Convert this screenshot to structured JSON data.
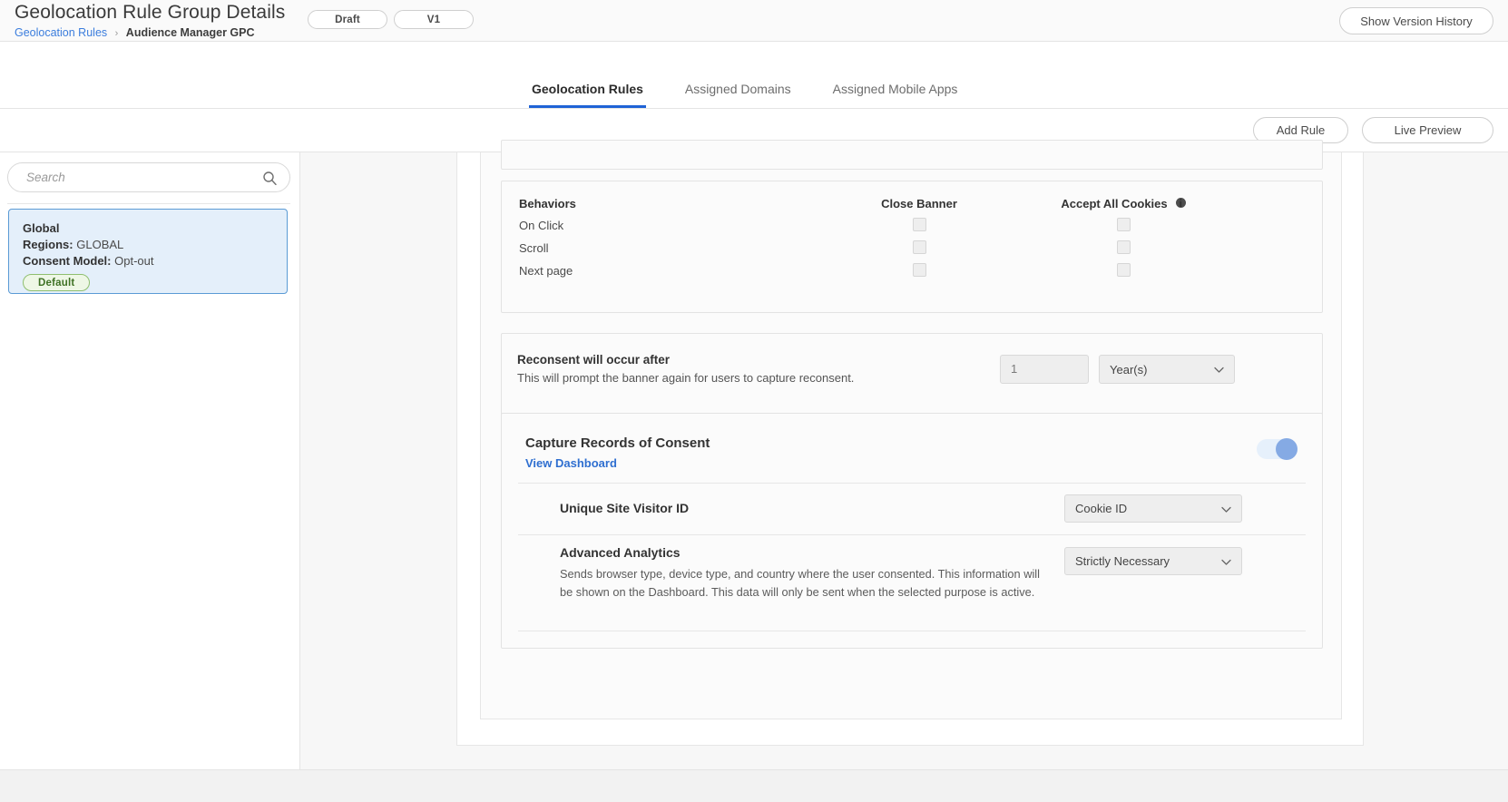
{
  "header": {
    "title": "Geolocation Rule Group Details",
    "breadcrumb": {
      "parent": "Geolocation Rules",
      "separator": "›",
      "current": "Audience Manager GPC"
    },
    "status_pill": "Draft",
    "version_pill": "V1",
    "version_history_button": "Show Version History"
  },
  "tabs": [
    {
      "label": "Geolocation Rules",
      "active": true
    },
    {
      "label": "Assigned Domains",
      "active": false
    },
    {
      "label": "Assigned Mobile Apps",
      "active": false
    }
  ],
  "actions": {
    "add_rule": "Add Rule",
    "live_preview": "Live Preview"
  },
  "sidebar": {
    "search_placeholder": "Search",
    "search_value": "",
    "search_icon": "search-icon",
    "rule": {
      "name": "Global",
      "regions_label": "Regions:",
      "regions_value": "GLOBAL",
      "consent_label": "Consent Model:",
      "consent_value": "Opt-out",
      "badge": "Default"
    }
  },
  "behaviors": {
    "header_label": "Behaviors",
    "columns": [
      "Close Banner",
      "Accept All Cookies"
    ],
    "info_icon": "info-icon",
    "rows": [
      {
        "label": "On Click",
        "close_banner": false,
        "accept_all": false
      },
      {
        "label": "Scroll",
        "close_banner": false,
        "accept_all": false
      },
      {
        "label": "Next page",
        "close_banner": false,
        "accept_all": false
      }
    ]
  },
  "reconsent": {
    "title": "Reconsent will occur after",
    "subtitle": "This will prompt the banner again for users to capture reconsent.",
    "value": "1",
    "unit": "Year(s)"
  },
  "capture": {
    "title": "Capture Records of Consent",
    "link": "View Dashboard",
    "toggle_on": true,
    "visitor_id": {
      "label": "Unique Site Visitor ID",
      "value": "Cookie ID"
    },
    "advanced_analytics": {
      "label": "Advanced Analytics",
      "description": "Sends browser type, device type, and country where the user consented. This information will be shown on the Dashboard. This data will only be sent when the selected purpose is active.",
      "value": "Strictly Necessary"
    }
  },
  "colors": {
    "accent_blue": "#1f63d6",
    "link_blue": "#2f6fd0",
    "card_selected_bg": "#e4effa",
    "card_selected_border": "#5b9bd5",
    "badge_green_text": "#3f7225",
    "toggle_track": "#e6f0fb",
    "toggle_knob": "#85aae4"
  }
}
